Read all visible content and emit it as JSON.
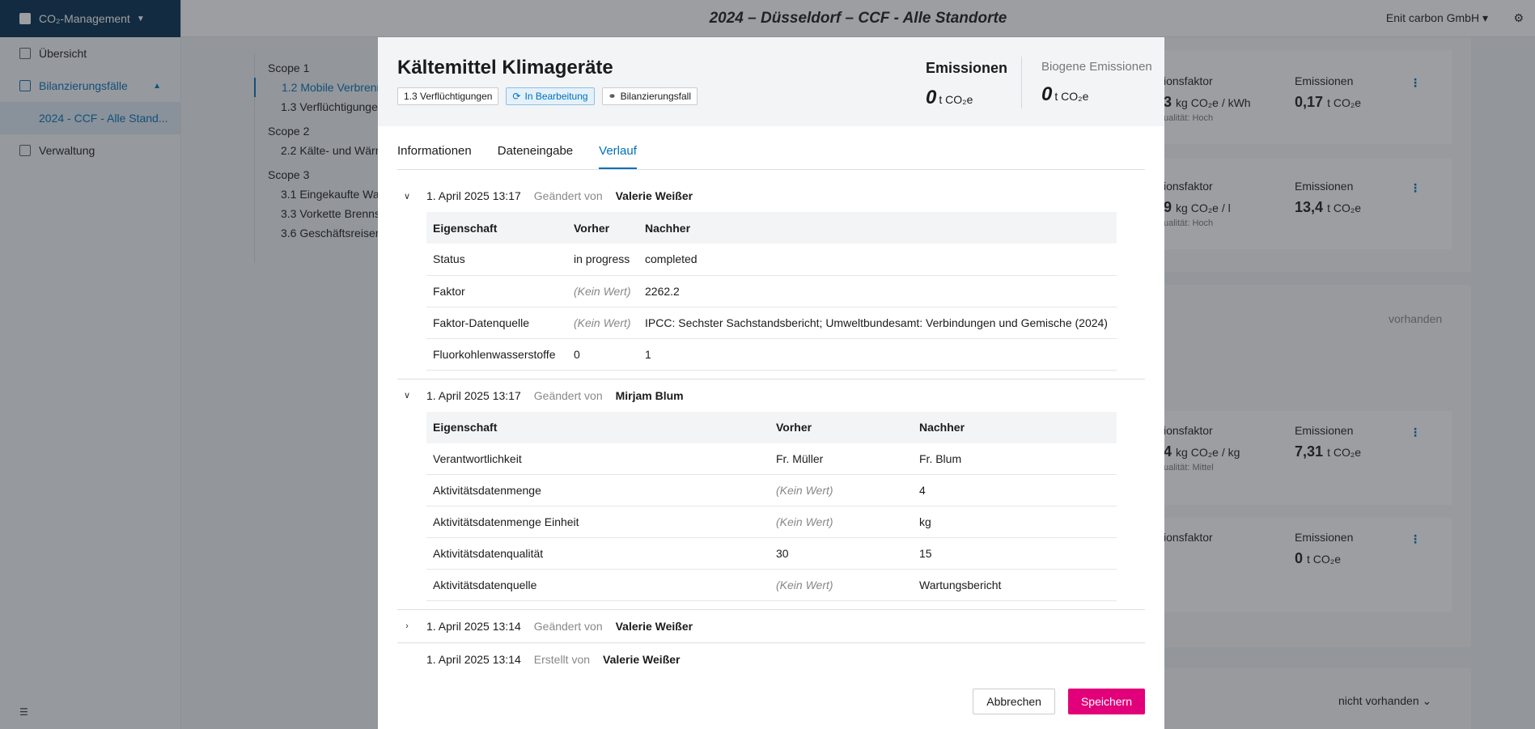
{
  "app": {
    "switcher_label": "CO₂-Management",
    "page_title": "2024 – Düsseldorf – CCF - Alle Standorte",
    "org": "Enit carbon GmbH"
  },
  "sidebar": {
    "items": [
      {
        "label": "Übersicht"
      },
      {
        "label": "Bilanzierungsfälle"
      },
      {
        "label": "2024 - CCF - Alle Stand..."
      },
      {
        "label": "Verwaltung"
      }
    ]
  },
  "scope_nav": {
    "groups": [
      {
        "label": "Scope 1",
        "items": [
          "1.2 Mobile Verbrenn",
          "1.3 Verflüchtigunge"
        ]
      },
      {
        "label": "Scope 2",
        "items": [
          "2.2 Kälte- und Wärm"
        ]
      },
      {
        "label": "Scope 3",
        "items": [
          "3.1 Eingekaufte War",
          "3.3 Vorkette Brenns",
          "3.6 Geschäftsreisen"
        ]
      }
    ]
  },
  "bg_cards": [
    {
      "factor_label": "ionsfaktor",
      "factor_value": "3",
      "factor_unit": "kg CO₂e / kWh",
      "quality": "ualität: Hoch",
      "em_label": "Emissionen",
      "em_value": "0,17",
      "em_unit": "t CO₂e"
    },
    {
      "factor_label": "ionsfaktor",
      "factor_value": "9",
      "factor_unit": "kg CO₂e / l",
      "quality": "ualität: Hoch",
      "em_label": "Emissionen",
      "em_value": "13,4",
      "em_unit": "t CO₂e"
    },
    {
      "factor_label": "ionsfaktor",
      "factor_value": "4",
      "factor_unit": "kg CO₂e / kg",
      "quality": "ualität: Mittel",
      "em_label": "Emissionen",
      "em_value": "7,31",
      "em_unit": "t CO₂e"
    },
    {
      "factor_label": "ionsfaktor",
      "factor_value": "",
      "factor_unit": "",
      "quality": "",
      "em_label": "Emissionen",
      "em_value": "0",
      "em_unit": "t CO₂e"
    }
  ],
  "bg_texts": {
    "vorhanden": "vorhanden",
    "nicht_vorhanden": "nicht vorhanden"
  },
  "modal": {
    "title": "Kältemittel Klimageräte",
    "badges": {
      "category": "1.3 Verflüchtigungen",
      "status": "In Bearbeitung",
      "type": "Bilanzierungsfall"
    },
    "emissions": {
      "label": "Emissionen",
      "value": "0",
      "unit": "t CO₂e"
    },
    "biogenic": {
      "label": "Biogene Emissionen",
      "value": "0",
      "unit": "t CO₂e"
    },
    "tabs": [
      "Informationen",
      "Dateneingabe",
      "Verlauf"
    ],
    "history": [
      {
        "date": "1. April 2025 13:17",
        "action": "Geändert von",
        "user": "Valerie Weißer",
        "columns": [
          "Eigenschaft",
          "Vorher",
          "Nachher"
        ],
        "rows": [
          {
            "prop": "Status",
            "before": "in progress",
            "after": "completed"
          },
          {
            "prop": "Faktor",
            "before": "(Kein Wert)",
            "after": "2262.2"
          },
          {
            "prop": "Faktor-Datenquelle",
            "before": "(Kein Wert)",
            "after": "IPCC: Sechster Sachstandsbericht; Umweltbundesamt: Verbindungen und Gemische (2024)"
          },
          {
            "prop": "Fluorkohlenwasserstoffe",
            "before": "0",
            "after": "1"
          }
        ]
      },
      {
        "date": "1. April 2025 13:17",
        "action": "Geändert von",
        "user": "Mirjam Blum",
        "columns": [
          "Eigenschaft",
          "Vorher",
          "Nachher"
        ],
        "rows": [
          {
            "prop": "Verantwortlichkeit",
            "before": "Fr. Müller",
            "after": "Fr. Blum"
          },
          {
            "prop": "Aktivitätsdatenmenge",
            "before": "(Kein Wert)",
            "after": "4"
          },
          {
            "prop": "Aktivitätsdatenmenge Einheit",
            "before": "(Kein Wert)",
            "after": "kg"
          },
          {
            "prop": "Aktivitätsdatenqualität",
            "before": "30",
            "after": "15"
          },
          {
            "prop": "Aktivitätsdatenquelle",
            "before": "(Kein Wert)",
            "after": "Wartungsbericht"
          }
        ]
      },
      {
        "date": "1. April 2025 13:14",
        "action": "Geändert von",
        "user": "Valerie Weißer"
      },
      {
        "date": "1. April 2025 13:14",
        "action": "Erstellt von",
        "user": "Valerie Weißer"
      }
    ],
    "buttons": {
      "cancel": "Abbrechen",
      "save": "Speichern"
    }
  },
  "colors": {
    "accent": "#0070b8",
    "primary_button": "#e2007a",
    "sidebar_header": "#002b4d"
  },
  "icons": [
    "app-logo-icon",
    "chevron-down-icon",
    "overview-icon",
    "cases-icon",
    "admin-icon",
    "gear-icon",
    "sync-icon",
    "hierarchy-icon",
    "kebab-menu-icon",
    "collapse-sidebar-icon"
  ]
}
